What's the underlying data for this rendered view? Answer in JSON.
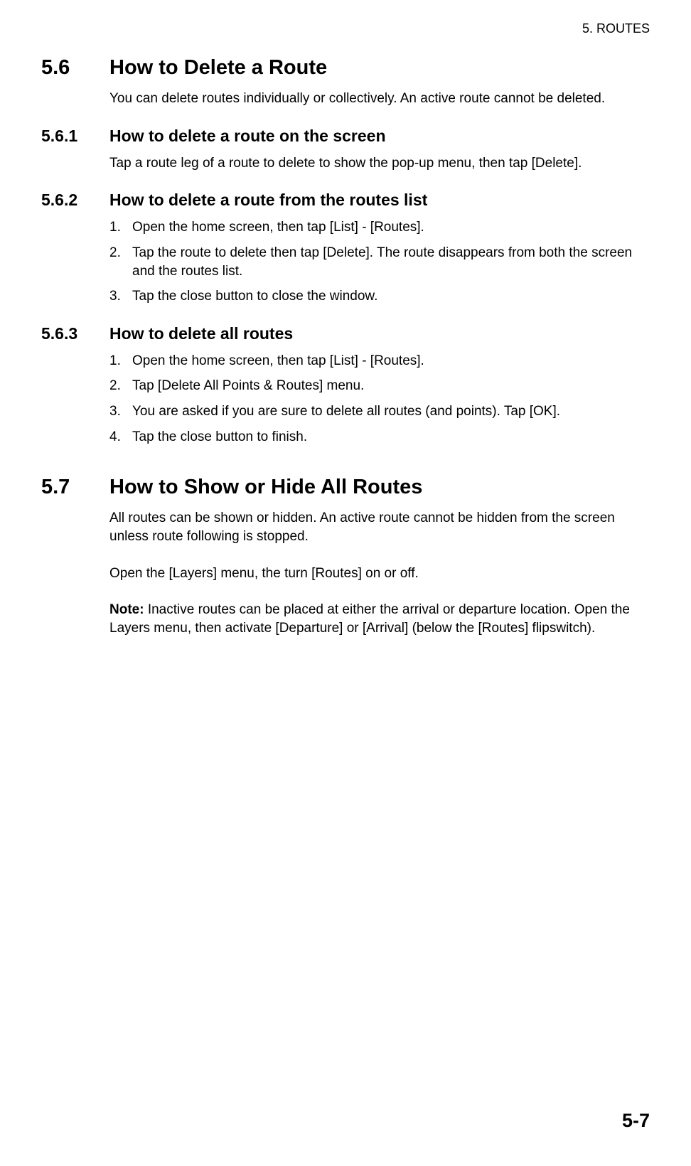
{
  "header": {
    "chapter": "5.  ROUTES"
  },
  "section56": {
    "number": "5.6",
    "title": "How to Delete a Route",
    "intro": "You can delete routes individually or collectively. An active route cannot be deleted."
  },
  "section561": {
    "number": "5.6.1",
    "title": "How to delete a route on the screen",
    "body": "Tap a route leg of a route to delete to show the pop-up menu, then tap [Delete]."
  },
  "section562": {
    "number": "5.6.2",
    "title": "How to delete a route from the routes list",
    "items": [
      {
        "n": "1.",
        "text": "Open the home screen, then tap [List] - [Routes]."
      },
      {
        "n": "2.",
        "text": "Tap the route to delete then tap [Delete]. The route disappears from both the screen and the routes list."
      },
      {
        "n": "3.",
        "text": "Tap the close button to close the window."
      }
    ]
  },
  "section563": {
    "number": "5.6.3",
    "title": "How to delete all routes",
    "items": [
      {
        "n": "1.",
        "text": "Open the home screen, then tap [List] - [Routes]."
      },
      {
        "n": "2.",
        "text": "Tap [Delete All Points & Routes] menu."
      },
      {
        "n": "3.",
        "text": "You are asked if you are sure to delete all routes (and points). Tap [OK]."
      },
      {
        "n": "4.",
        "text": "Tap the close button to finish."
      }
    ]
  },
  "section57": {
    "number": "5.7",
    "title": "How to Show or Hide All Routes",
    "para1": "All routes can be shown or hidden. An active route cannot be hidden from the screen unless route following is stopped.",
    "para2": "Open the [Layers] menu, the turn [Routes] on or off.",
    "noteLabel": "Note:",
    "noteText": " Inactive routes can be placed at either the arrival or departure location. Open the Layers menu, then activate [Departure] or [Arrival] (below the [Routes] flipswitch)."
  },
  "pageNumber": "5-7"
}
